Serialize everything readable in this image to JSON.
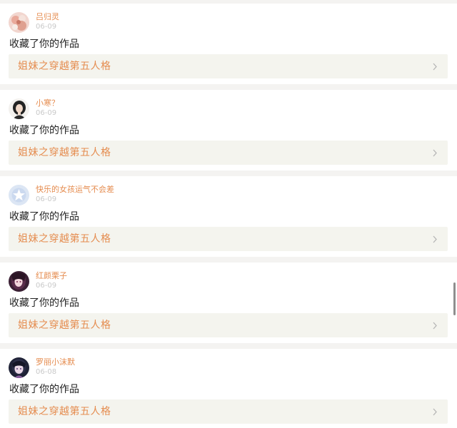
{
  "feed": {
    "items": [
      {
        "username": "吕归灵",
        "date": "06-09",
        "action": "收藏了你的作品",
        "work_title": "姐妹之穿越第五人格",
        "avatar_icon": "avatar-pink-floral"
      },
      {
        "username": "小寒？",
        "date": "06-09",
        "action": "收藏了你的作品",
        "work_title": "姐妹之穿越第五人格",
        "avatar_icon": "avatar-girl-dark-hair"
      },
      {
        "username": "快乐的女孩运气不会差",
        "date": "06-09",
        "action": "收藏了你的作品",
        "work_title": "姐妹之穿越第五人格",
        "avatar_icon": "avatar-default-star"
      },
      {
        "username": "红颜栗子",
        "date": "06-09",
        "action": "收藏了你的作品",
        "work_title": "姐妹之穿越第五人格",
        "avatar_icon": "avatar-anime-girl-purple"
      },
      {
        "username": "罗丽小沫默",
        "date": "06-08",
        "action": "收藏了你的作品",
        "work_title": "姐妹之穿越第五人格",
        "avatar_icon": "avatar-anime-girl-dark"
      }
    ]
  },
  "colors": {
    "accent": "#e58c4f",
    "date_gray": "#c9c9c9",
    "link_bg": "#f4f4ee",
    "page_bg": "#f4f3f1"
  }
}
